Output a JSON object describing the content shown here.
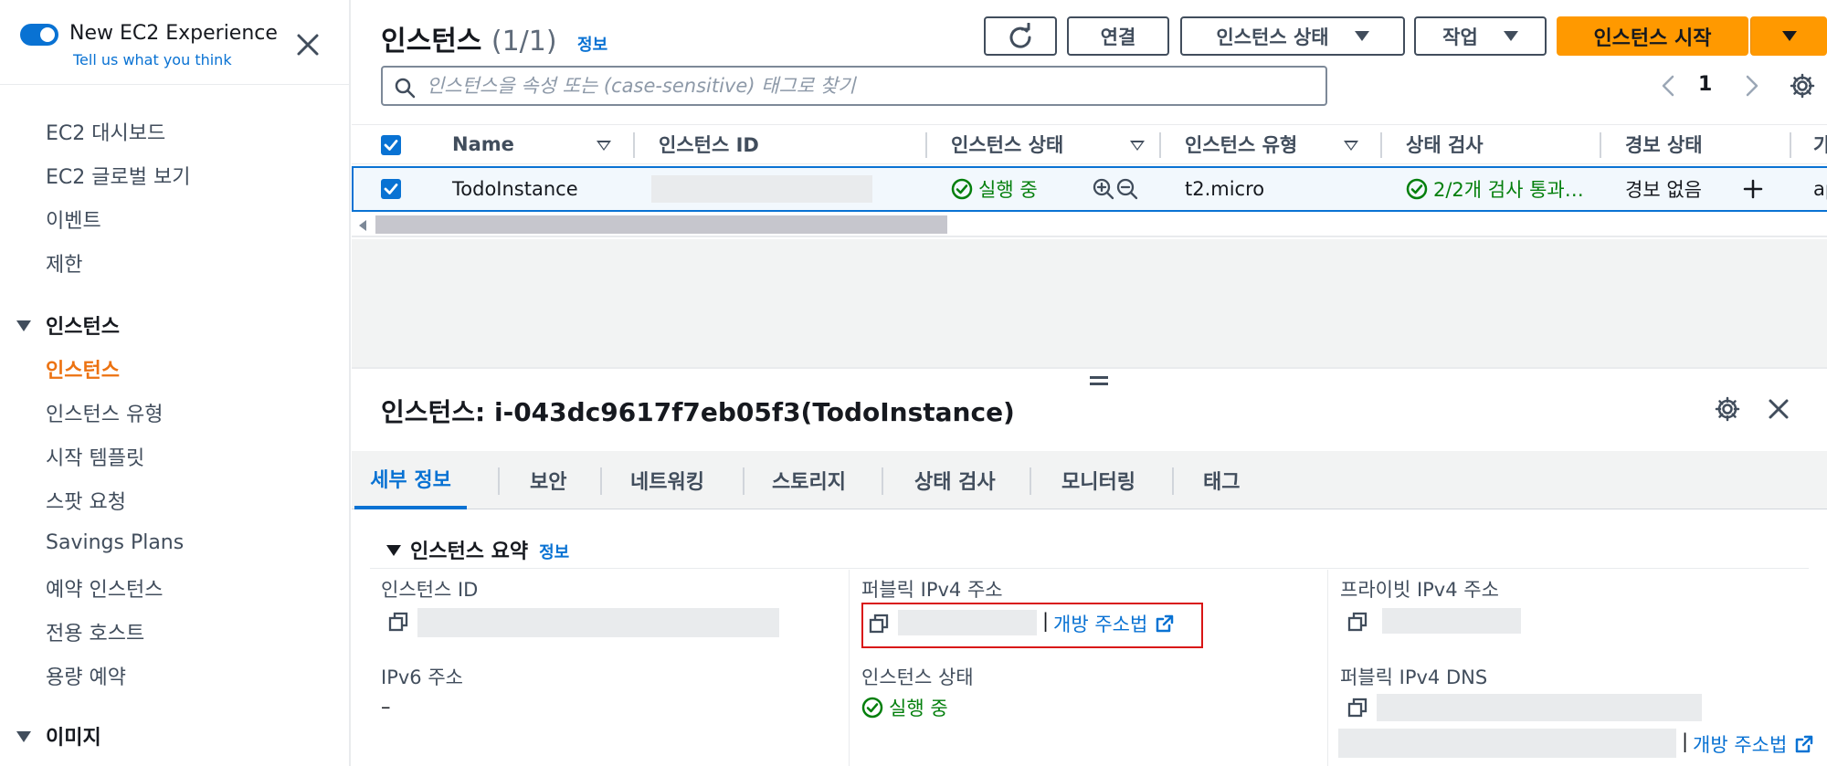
{
  "sidebar": {
    "experience_title": "New EC2 Experience",
    "experience_feedback": "Tell us what you think",
    "items_top": [
      "EC2 대시보드",
      "EC2 글로벌 보기",
      "이벤트",
      "제한"
    ],
    "section_instances": "인스턴스",
    "instance_items": [
      "인스턴스",
      "인스턴스 유형",
      "시작 템플릿",
      "스팟 요청",
      "Savings Plans",
      "예약 인스턴스",
      "전용 호스트",
      "용량 예약"
    ],
    "section_images": "이미지",
    "active_item": "인스턴스"
  },
  "list": {
    "title": "인스턴스",
    "count": "(1/1)",
    "info": "정보",
    "buttons": {
      "connect": "연결",
      "instance_state": "인스턴스 상태",
      "actions": "작업",
      "launch": "인스턴스 시작"
    },
    "search_placeholder": "인스턴스을 속성 또는 (case-sensitive) 태그로 찾기",
    "page": "1",
    "columns": [
      "Name",
      "인스턴스 ID",
      "인스턴스 상태",
      "인스턴스 유형",
      "상태 검사",
      "경보 상태",
      "가"
    ],
    "rows": [
      {
        "name": "TodoInstance",
        "state": "실행 중",
        "type": "t2.micro",
        "status_check": "2/2개 검사 통과…",
        "alarm": "경보 없음",
        "az": "ap"
      }
    ]
  },
  "detail": {
    "title": "인스턴스: i-043dc9617f7eb05f3(TodoInstance)",
    "tabs": [
      "세부 정보",
      "보안",
      "네트워킹",
      "스토리지",
      "상태 검사",
      "모니터링",
      "태그"
    ],
    "active_tab": "세부 정보",
    "section_title": "인스턴스 요약",
    "section_info": "정보",
    "fields": {
      "instance_id_label": "인스턴스 ID",
      "public_ipv4_label": "퍼블릭 IPv4 주소",
      "private_ipv4_label": "프라이빗 IPv4 주소",
      "ipv6_label": "IPv6 주소",
      "ipv6_value": "–",
      "state_label": "인스턴스 상태",
      "state_value": "실행 중",
      "public_dns_label": "퍼블릭 IPv4 DNS",
      "open_address_link": "개방 주소법",
      "ip_separator": "|"
    }
  },
  "colors": {
    "accent": "#0972d3",
    "primary_button": "#ff9900",
    "success": "#037f0c",
    "active_nav": "#ec7211",
    "highlight": "#d91515"
  }
}
